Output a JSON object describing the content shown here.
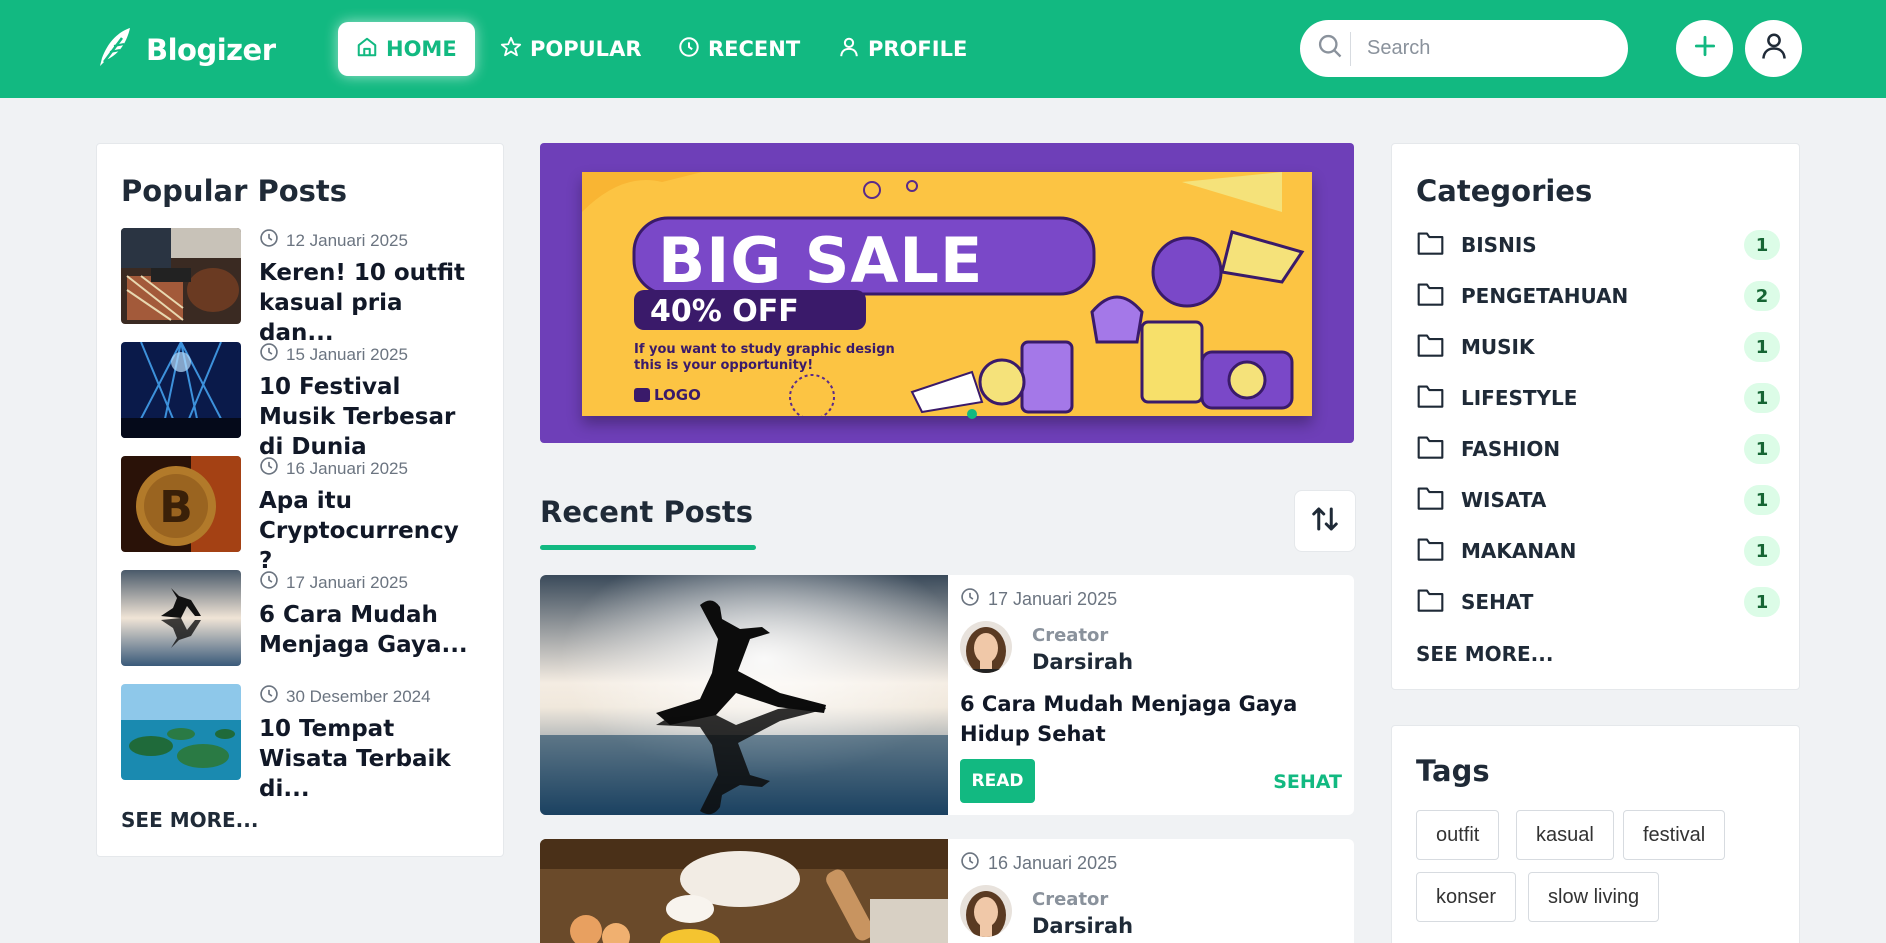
{
  "brand": {
    "name": "Blogizer"
  },
  "nav": [
    {
      "label": "HOME",
      "icon": "home-icon",
      "active": true
    },
    {
      "label": "POPULAR",
      "icon": "star-icon",
      "active": false
    },
    {
      "label": "RECENT",
      "icon": "clock-icon",
      "active": false
    },
    {
      "label": "PROFILE",
      "icon": "user-icon",
      "active": false
    }
  ],
  "search": {
    "placeholder": "Search",
    "value": ""
  },
  "colors": {
    "primary": "#12b981",
    "banner_bg": "#6e3fb8",
    "banner_inner": "#fcc443"
  },
  "popular": {
    "title": "Popular Posts",
    "see_more": "SEE MORE...",
    "items": [
      {
        "date": "12 Januari 2025",
        "title": "Keren! 10 outfit kasual pria dan..."
      },
      {
        "date": "15 Januari 2025",
        "title": "10 Festival Musik Terbesar di Dunia"
      },
      {
        "date": "16 Januari 2025",
        "title": "Apa itu Cryptocurrency ?"
      },
      {
        "date": "17 Januari 2025",
        "title": "6 Cara Mudah Menjaga Gaya..."
      },
      {
        "date": "30 Desember 2024",
        "title": "10 Tempat Wisata Terbaik di..."
      }
    ]
  },
  "banner": {
    "headline": "BIG SALE",
    "discount": "40% OFF",
    "tagline_1": "If you want to study graphic design",
    "tagline_2": "this is your opportunity!",
    "logo": "LOGO"
  },
  "recent": {
    "title": "Recent Posts",
    "posts": [
      {
        "date": "17 Januari 2025",
        "creator_label": "Creator",
        "creator": "Darsirah",
        "title": "6 Cara Mudah Menjaga Gaya Hidup Sehat",
        "read": "READ",
        "category": "SEHAT"
      },
      {
        "date": "16 Januari 2025",
        "creator_label": "Creator",
        "creator": "Darsirah"
      }
    ]
  },
  "categories": {
    "title": "Categories",
    "see_more": "SEE MORE...",
    "items": [
      {
        "name": "BISNIS",
        "count": "1"
      },
      {
        "name": "PENGETAHUAN",
        "count": "2"
      },
      {
        "name": "MUSIK",
        "count": "1"
      },
      {
        "name": "LIFESTYLE",
        "count": "1"
      },
      {
        "name": "FASHION",
        "count": "1"
      },
      {
        "name": "WISATA",
        "count": "1"
      },
      {
        "name": "MAKANAN",
        "count": "1"
      },
      {
        "name": "SEHAT",
        "count": "1"
      }
    ]
  },
  "tags": {
    "title": "Tags",
    "items": [
      "outfit",
      "kasual",
      "festival",
      "konser",
      "slow living"
    ]
  }
}
